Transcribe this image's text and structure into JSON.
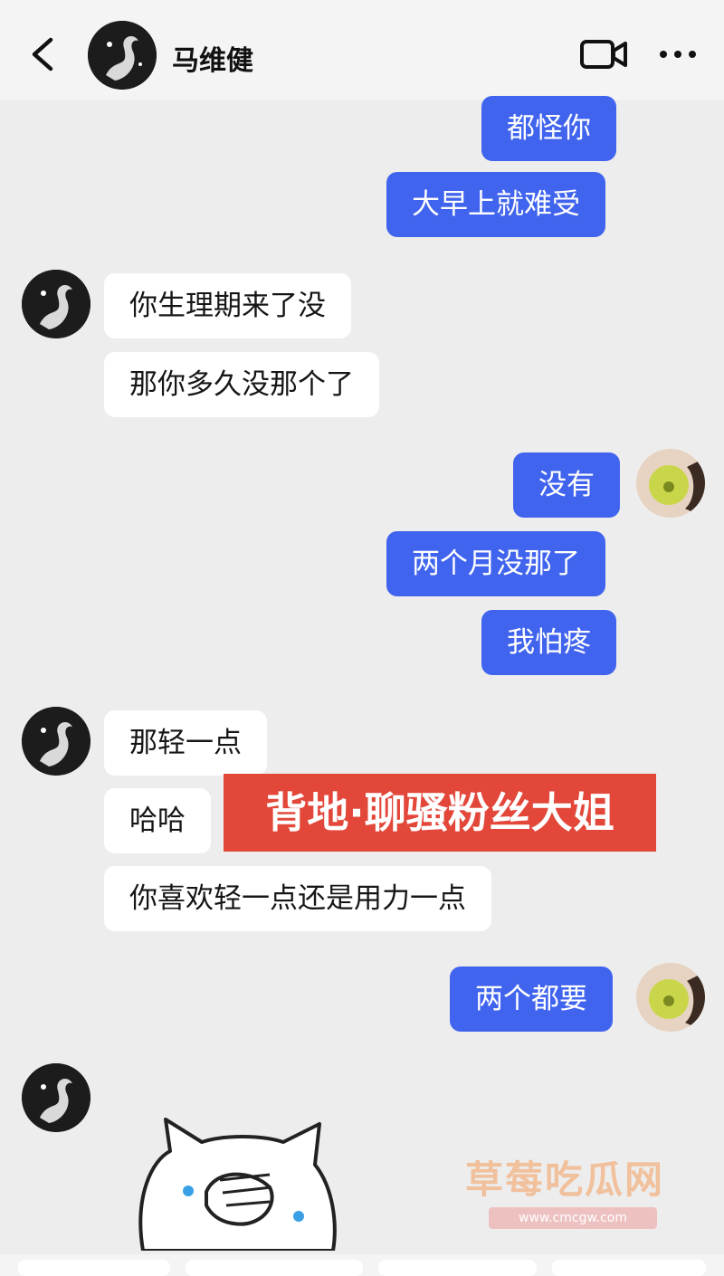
{
  "header": {
    "contact_name": "马维健",
    "back_icon": "back-arrow-icon",
    "video_icon": "video-call-icon",
    "more_icon": "more-options-icon"
  },
  "messages": [
    {
      "side": "sent",
      "text": "都怪你"
    },
    {
      "side": "sent",
      "text": "大早上就难受"
    },
    {
      "side": "received",
      "text": "你生理期来了没"
    },
    {
      "side": "received",
      "text": "那你多久没那个了"
    },
    {
      "side": "sent",
      "text": "没有"
    },
    {
      "side": "sent",
      "text": "两个月没那了"
    },
    {
      "side": "sent",
      "text": "我怕疼"
    },
    {
      "side": "received",
      "text": "那轻一点"
    },
    {
      "side": "received",
      "text": "哈哈"
    },
    {
      "side": "received",
      "text": "你喜欢轻一点还是用力一点"
    },
    {
      "side": "sent",
      "text": "两个都要"
    },
    {
      "side": "received",
      "text": "",
      "sticker": "cat-covering-face-sticker"
    }
  ],
  "overlay_banner": "背地·聊骚粉丝大姐",
  "watermark": {
    "text": "草莓吃瓜网",
    "url": "www.cmcgw.com"
  },
  "colors": {
    "sent_bubble": "#4064ee",
    "received_bubble": "#ffffff",
    "banner": "#e2473a",
    "background": "#ededed"
  }
}
